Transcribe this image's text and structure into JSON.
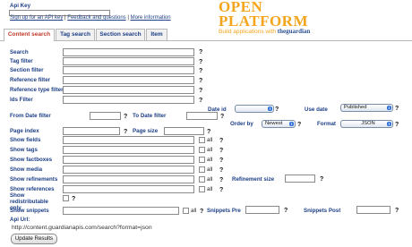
{
  "header": {
    "api_key_label": "Api Key",
    "signup_link": "Sign up for an API key",
    "feedback_link": "Feedback and questions",
    "more_info_link": "More information",
    "separator": "|",
    "logo_title": "OPEN PLATFORM",
    "logo_subtitle": "Build applications with",
    "logo_brand": "theguardian"
  },
  "tabs": [
    {
      "label": "Content search"
    },
    {
      "label": "Tag search"
    },
    {
      "label": "Section search"
    },
    {
      "label": "Item"
    }
  ],
  "form": {
    "search_label": "Search",
    "tag_filter_label": "Tag filter",
    "section_filter_label": "Section filter",
    "reference_filter_label": "Reference filter",
    "reference_type_filter_label": "Reference type filter",
    "ids_filter_label": "Ids Filter",
    "date_id_label": "Date id",
    "use_date_label": "Use date",
    "use_date_value": "Published",
    "from_date_label": "From Date filter",
    "to_date_label": "To Date filter",
    "order_by_label": "Order by",
    "order_by_value": "Newest",
    "format_label": "Format",
    "format_value": "JSON",
    "page_index_label": "Page index",
    "page_size_label": "Page size",
    "show_fields_label": "Show fields",
    "show_tags_label": "Show tags",
    "show_factboxes_label": "Show factboxes",
    "show_media_label": "Show media",
    "show_refinements_label": "Show refinements",
    "refinement_size_label": "Refinement size",
    "show_references_label": "Show references",
    "show_redistributable_label": "Show redistributable only",
    "show_snippets_label": "Show snippets",
    "snippets_pre_label": "Snippets Pre",
    "snippets_post_label": "Snippets Post",
    "all_label": "all",
    "help_mark": "?"
  },
  "api_url": {
    "label": "Api Url:",
    "value": "http://content.guardianapis.com/search?format=json"
  },
  "update_button": "Update Results"
}
